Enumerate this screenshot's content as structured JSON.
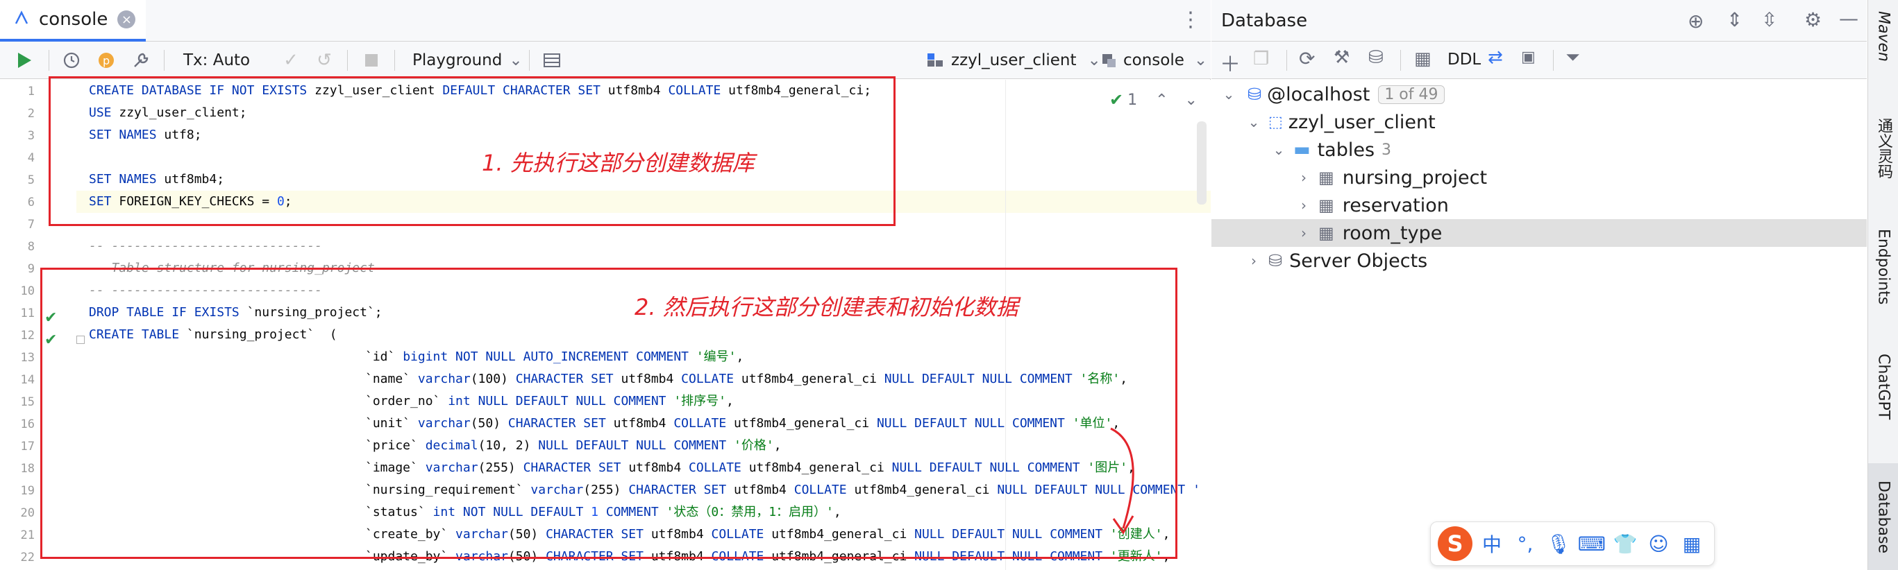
{
  "editor": {
    "tab_label": "console",
    "toolbar": {
      "tx_label": "Tx: Auto",
      "playground_label": "Playground",
      "datasource_label": "zzyl_user_client",
      "session_label": "console"
    },
    "inspection_count": "1",
    "line_numbers": [
      "1",
      "2",
      "3",
      "4",
      "5",
      "6",
      "7",
      "8",
      "9",
      "10",
      "11",
      "12",
      "13",
      "14",
      "15",
      "16",
      "17",
      "18",
      "19",
      "20",
      "21",
      "22"
    ],
    "lines": {
      "l1_kw1": "CREATE DATABASE IF NOT EXISTS ",
      "l1_db": "zzyl_user_client",
      "l1_kw2": " DEFAULT CHARACTER SET ",
      "l1_cs": "utf8mb4",
      "l1_kw3": " COLLATE ",
      "l1_coll": "utf8mb4_general_ci;",
      "l2_kw": "USE ",
      "l2_rest": "zzyl_user_client;",
      "l3_kw": "SET NAMES ",
      "l3_rest": "utf8;",
      "l5_kw": "SET NAMES ",
      "l5_rest": "utf8mb4;",
      "l6_kw": "SET ",
      "l6_rest": "FOREIGN_KEY_CHECKS = ",
      "l6_num": "0",
      "l6_end": ";",
      "l8": "-- ----------------------------",
      "l9": "-- Table structure for nursing_project",
      "l10": "-- ----------------------------",
      "l11_kw": "DROP TABLE IF EXISTS ",
      "l11_rest": "`nursing_project`;",
      "l12_kw": "CREATE TABLE ",
      "l12_rest": "`nursing_project`  (",
      "l13_a": "`id` ",
      "l13_kw": "bigint NOT NULL AUTO_INCREMENT COMMENT ",
      "l13_str": "'编号'",
      "l13_end": ",",
      "l14_a": "`name` ",
      "l14_kw": "varchar",
      "l14_b": "(100) ",
      "l14_kw2": "CHARACTER SET ",
      "l14_c": "utf8mb4 ",
      "l14_kw3": "COLLATE ",
      "l14_d": "utf8mb4_general_ci ",
      "l14_kw4": "NULL DEFAULT NULL COMMENT ",
      "l14_str": "'名称'",
      "l14_end": ",",
      "l15_a": "`order_no` ",
      "l15_kw": "int NULL DEFAULT NULL COMMENT ",
      "l15_str": "'排序号'",
      "l15_end": ",",
      "l16_a": "`unit` ",
      "l16_kw": "varchar",
      "l16_b": "(50) ",
      "l16_kw2": "CHARACTER SET ",
      "l16_c": "utf8mb4 ",
      "l16_kw3": "COLLATE ",
      "l16_d": "utf8mb4_general_ci ",
      "l16_kw4": "NULL DEFAULT NULL COMMENT ",
      "l16_str": "'单位'",
      "l16_end": ",",
      "l17_a": "`price` ",
      "l17_kw": "decimal",
      "l17_b": "(10, 2) ",
      "l17_kw2": "NULL DEFAULT NULL COMMENT ",
      "l17_str": "'价格'",
      "l17_end": ",",
      "l18_a": "`image` ",
      "l18_kw": "varchar",
      "l18_b": "(255) ",
      "l18_kw2": "CHARACTER SET ",
      "l18_c": "utf8mb4 ",
      "l18_kw3": "COLLATE ",
      "l18_d": "utf8mb4_general_ci ",
      "l18_kw4": "NULL DEFAULT NULL COMMENT ",
      "l18_str": "'图片'",
      "l18_end": ",",
      "l19_a": "`nursing_requirement` ",
      "l19_kw": "varchar",
      "l19_b": "(255) ",
      "l19_kw2": "CHARACTER SET ",
      "l19_c": "utf8mb4 ",
      "l19_kw3": "COLLATE ",
      "l19_d": "utf8mb4_general_ci ",
      "l19_kw4": "NULL DEFAULT NULL COMMENT '",
      "l20_a": "`status` ",
      "l20_kw": "int NOT NULL DEFAULT ",
      "l20_num": "1 ",
      "l20_kw2": "COMMENT ",
      "l20_str": "'状态（0：禁用，1：启用）'",
      "l20_end": ",",
      "l21_a": "`create_by` ",
      "l21_kw": "varchar",
      "l21_b": "(50) ",
      "l21_kw2": "CHARACTER SET ",
      "l21_c": "utf8mb4 ",
      "l21_kw3": "COLLATE ",
      "l21_d": "utf8mb4_general_ci ",
      "l21_kw4": "NULL DEFAULT NULL COMMENT ",
      "l21_str": "'创建人'",
      "l21_end": ",",
      "l22_a": "`update_by` ",
      "l22_kw": "varchar",
      "l22_b": "(50) ",
      "l22_kw2": "CHARACTER SET ",
      "l22_c": "utf8mb4 ",
      "l22_kw3": "COLLATE ",
      "l22_d": "utf8mb4_general_ci ",
      "l22_kw4": "NULL DEFAULT NULL COMMENT ",
      "l22_str": "'更新人'",
      "l22_end": ","
    },
    "annotations": {
      "step1": "1. 先执行这部分创建数据库",
      "step2": "2. 然后执行这部分创建表和初始化数据"
    }
  },
  "database": {
    "title": "Database",
    "ddl_label": "DDL",
    "tree": {
      "host": "@localhost",
      "host_badge": "1 of 49",
      "schema": "zzyl_user_client",
      "tables_label": "tables",
      "tables_count": "3",
      "table1": "nursing_project",
      "table2": "reservation",
      "table3": "room_type",
      "server_objects": "Server Objects"
    }
  },
  "right_strip": {
    "maven": "Maven",
    "tongyi": "通义灵码",
    "endpoints": "Endpoints",
    "chatgpt": "ChatGPT",
    "database": "Database"
  },
  "ime": {
    "logo": "S",
    "lang": "中",
    "punct": "°,"
  },
  "colors": {
    "accent": "#3574f0",
    "annotation": "#e3242b",
    "keyword": "#0033b3",
    "string": "#067d17",
    "run_green": "#2e9b4a"
  }
}
